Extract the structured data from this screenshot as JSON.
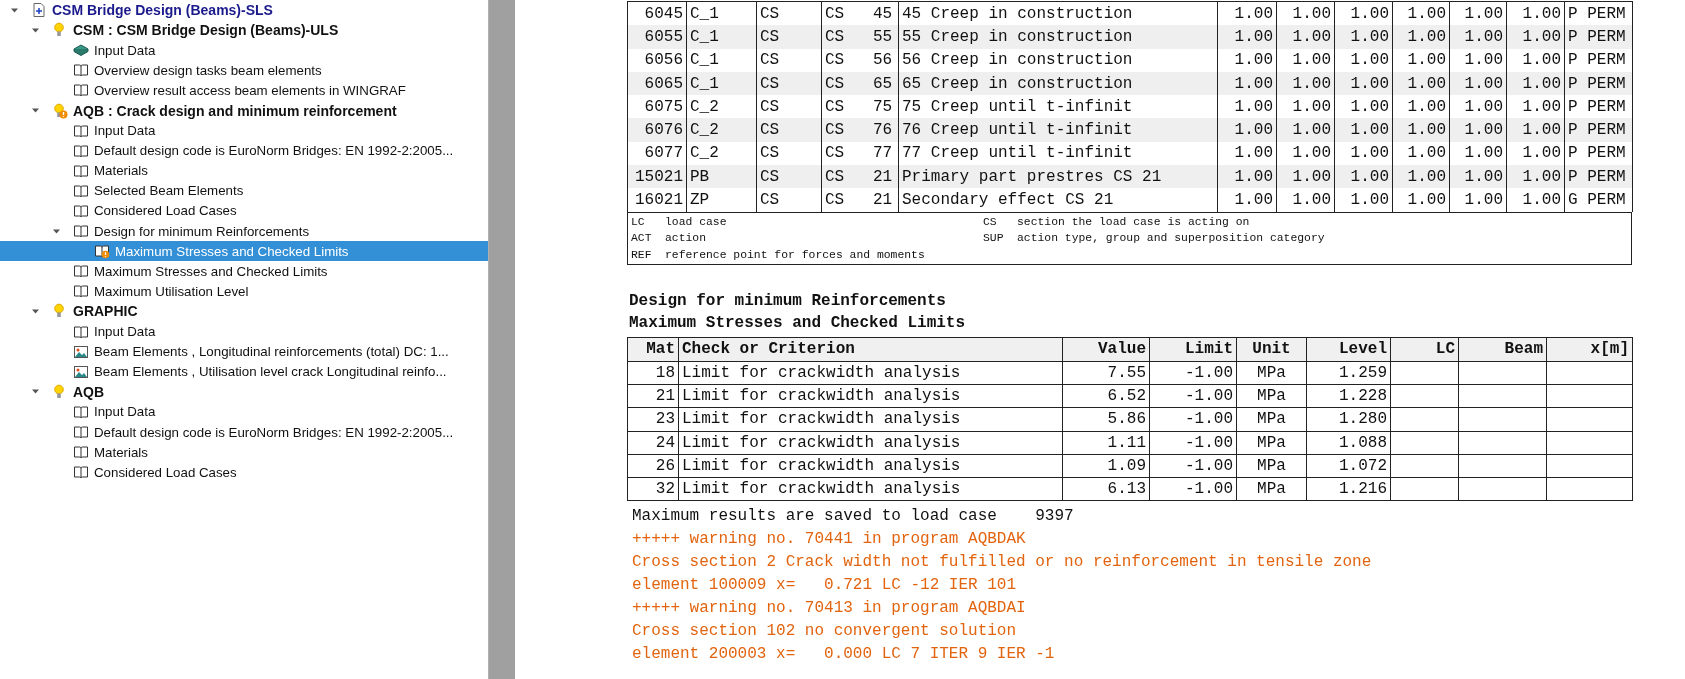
{
  "tree": [
    {
      "label": "CSM Bridge Design (Beams)-SLS",
      "kind": "document",
      "expanded": true,
      "selected": false,
      "children": [
        {
          "label": "CSM : CSM Bridge Design (Beams)-ULS",
          "kind": "module",
          "expanded": true,
          "selected": false,
          "children": [
            {
              "label": "Input Data",
              "kind": "book-closed",
              "selected": false
            },
            {
              "label": "Overview design tasks beam elements",
              "kind": "book",
              "selected": false
            },
            {
              "label": "Overview result access beam elements in WINGRAF",
              "kind": "book",
              "selected": false
            }
          ]
        },
        {
          "label": "AQB : Crack design and minimum reinforcement",
          "kind": "module-warning",
          "expanded": true,
          "selected": false,
          "children": [
            {
              "label": "Input Data",
              "kind": "book",
              "selected": false
            },
            {
              "label": "Default design code is EuroNorm Bridges: EN 1992-2:2005...",
              "kind": "book",
              "selected": false
            },
            {
              "label": "Materials",
              "kind": "book",
              "selected": false
            },
            {
              "label": "Selected Beam Elements",
              "kind": "book",
              "selected": false
            },
            {
              "label": "Considered Load Cases",
              "kind": "book",
              "selected": false
            },
            {
              "label": "Design for minimum Reinforcements",
              "kind": "book",
              "expanded": true,
              "selected": false,
              "children": [
                {
                  "label": "Maximum Stresses and Checked Limits",
                  "kind": "book-warning",
                  "selected": true
                }
              ]
            },
            {
              "label": "Maximum Stresses and Checked Limits",
              "kind": "book",
              "selected": false
            },
            {
              "label": "Maximum Utilisation Level",
              "kind": "book",
              "selected": false
            }
          ]
        },
        {
          "label": "GRAPHIC",
          "kind": "module",
          "expanded": true,
          "selected": false,
          "children": [
            {
              "label": "Input Data",
              "kind": "book",
              "selected": false
            },
            {
              "label": "Beam Elements , Longitudinal reinforcements (total) DC: 1...",
              "kind": "picture",
              "selected": false
            },
            {
              "label": "Beam Elements , Utilisation level crack Longitudinal reinfo...",
              "kind": "picture",
              "selected": false
            }
          ]
        },
        {
          "label": "AQB",
          "kind": "module",
          "expanded": true,
          "selected": false,
          "children": [
            {
              "label": "Input Data",
              "kind": "book",
              "selected": false
            },
            {
              "label": "Default design code is EuroNorm Bridges: EN 1992-2:2005...",
              "kind": "book",
              "selected": false
            },
            {
              "label": "Materials",
              "kind": "book",
              "selected": false
            },
            {
              "label": "Considered Load Cases",
              "kind": "book",
              "selected": false
            }
          ]
        }
      ]
    }
  ],
  "load_case_table": {
    "rows": [
      [
        "6045",
        "C_1",
        "CS",
        "CS   45",
        "45 Creep in construction",
        "1.00",
        "1.00",
        "1.00",
        "1.00",
        "1.00",
        "1.00",
        "P PERM"
      ],
      [
        "6055",
        "C_1",
        "CS",
        "CS   55",
        "55 Creep in construction",
        "1.00",
        "1.00",
        "1.00",
        "1.00",
        "1.00",
        "1.00",
        "P PERM"
      ],
      [
        "6056",
        "C_1",
        "CS",
        "CS   56",
        "56 Creep in construction",
        "1.00",
        "1.00",
        "1.00",
        "1.00",
        "1.00",
        "1.00",
        "P PERM"
      ],
      [
        "6065",
        "C_1",
        "CS",
        "CS   65",
        "65 Creep in construction",
        "1.00",
        "1.00",
        "1.00",
        "1.00",
        "1.00",
        "1.00",
        "P PERM"
      ],
      [
        "6075",
        "C_2",
        "CS",
        "CS   75",
        "75 Creep until t-infinit",
        "1.00",
        "1.00",
        "1.00",
        "1.00",
        "1.00",
        "1.00",
        "P PERM"
      ],
      [
        "6076",
        "C_2",
        "CS",
        "CS   76",
        "76 Creep until t-infinit",
        "1.00",
        "1.00",
        "1.00",
        "1.00",
        "1.00",
        "1.00",
        "P PERM"
      ],
      [
        "6077",
        "C_2",
        "CS",
        "CS   77",
        "77 Creep until t-infinit",
        "1.00",
        "1.00",
        "1.00",
        "1.00",
        "1.00",
        "1.00",
        "P PERM"
      ],
      [
        "15021",
        "PB",
        "CS",
        "CS   21",
        "Primary part prestres CS 21",
        "1.00",
        "1.00",
        "1.00",
        "1.00",
        "1.00",
        "1.00",
        "P PERM"
      ],
      [
        "16021",
        "ZP",
        "CS",
        "CS   21",
        "Secondary effect CS 21",
        "1.00",
        "1.00",
        "1.00",
        "1.00",
        "1.00",
        "1.00",
        "G PERM"
      ]
    ],
    "legend": [
      {
        "abbr": "LC",
        "text": "load case"
      },
      {
        "abbr": "CS",
        "text": "section the load case is acting on"
      },
      {
        "abbr": "ACT",
        "text": "action"
      },
      {
        "abbr": "SUP",
        "text": "action type, group and superposition category"
      },
      {
        "abbr": "REF",
        "text": "reference point for forces and moments"
      }
    ]
  },
  "headings": [
    "Design for minimum Reinforcements",
    "Maximum Stresses and Checked Limits"
  ],
  "limits_table": {
    "columns": [
      "Mat",
      "Check or Criterion",
      "Value",
      "Limit",
      "Unit",
      "Level",
      "LC",
      "Beam",
      "x[m]"
    ],
    "rows": [
      [
        "18",
        "Limit for crackwidth analysis",
        "7.55",
        "-1.00",
        "MPa",
        "1.259",
        "",
        "",
        ""
      ],
      [
        "21",
        "Limit for crackwidth analysis",
        "6.52",
        "-1.00",
        "MPa",
        "1.228",
        "",
        "",
        ""
      ],
      [
        "23",
        "Limit for crackwidth analysis",
        "5.86",
        "-1.00",
        "MPa",
        "1.280",
        "",
        "",
        ""
      ],
      [
        "24",
        "Limit for crackwidth analysis",
        "1.11",
        "-1.00",
        "MPa",
        "1.088",
        "",
        "",
        ""
      ],
      [
        "26",
        "Limit for crackwidth analysis",
        "1.09",
        "-1.00",
        "MPa",
        "1.072",
        "",
        "",
        ""
      ],
      [
        "32",
        "Limit for crackwidth analysis",
        "6.13",
        "-1.00",
        "MPa",
        "1.216",
        "",
        "",
        ""
      ]
    ]
  },
  "messages": [
    {
      "kind": "info",
      "text": "Maximum results are saved to load case    9397"
    },
    {
      "kind": "warning",
      "text": "+++++ warning no. 70441 in program AQBDAK"
    },
    {
      "kind": "warning",
      "text": "Cross section 2 Crack width not fulfilled or no reinforcement in tensile zone"
    },
    {
      "kind": "warning",
      "text": "element 100009 x=   0.721 LC -12 IER 101"
    },
    {
      "kind": "warning",
      "text": "+++++ warning no. 70413 in program AQBDAI"
    },
    {
      "kind": "warning",
      "text": "Cross section 102 no convergent solution"
    },
    {
      "kind": "warning",
      "text": "element 200003 x=   0.000 LC 7 ITER 9 IER -1"
    }
  ]
}
